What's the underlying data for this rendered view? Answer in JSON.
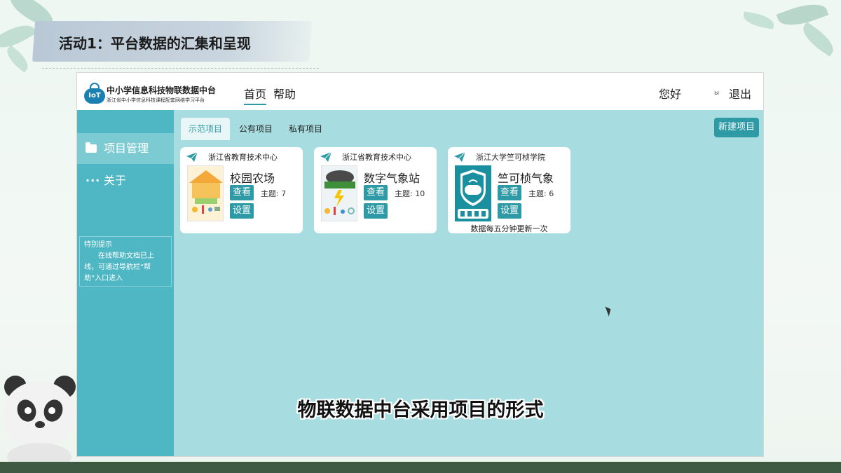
{
  "slide": {
    "title": "活动1：平台数据的汇集和呈现",
    "subtitle": "物联数据中台采用项目的形式"
  },
  "app": {
    "brand": {
      "logo_text": "IoT",
      "name": "中小学信息科技物联数据中台",
      "tagline": "浙江省中小学信息科技课程配套网络学习平台"
    },
    "nav": {
      "home": "首页",
      "help": "帮助"
    },
    "user": {
      "greeting": "您好",
      "icon_text": "ы",
      "logout": "退出"
    },
    "sidebar": {
      "items": [
        {
          "label": "项目管理",
          "icon": "folder-icon"
        },
        {
          "label": "关于",
          "icon": "more-icon",
          "glyph": "···"
        }
      ],
      "notice_title": "特别提示",
      "notice_body": "在线帮助文档已上线，可通过导航栏“帮助”入口进入"
    },
    "tabs": [
      "示范项目",
      "公有项目",
      "私有项目"
    ],
    "new_project": "新建项目",
    "cards": [
      {
        "org": "浙江省教育技术中心",
        "name": "校园农场",
        "view": "查看",
        "settings": "设置",
        "topics": "主题: 7",
        "note": ""
      },
      {
        "org": "浙江省教育技术中心",
        "name": "数字气象站",
        "view": "查看",
        "settings": "设置",
        "topics": "主题: 10",
        "note": ""
      },
      {
        "org": "浙江大学竺可桢学院",
        "name": "竺可桢气象",
        "view": "查看",
        "settings": "设置",
        "topics": "主题: 6",
        "note": "数据每五分钟更新一次"
      }
    ]
  },
  "colors": {
    "accent": "#2e9aa5",
    "sidebar": "#4fb7c4",
    "content_bg": "#a7dde0"
  }
}
